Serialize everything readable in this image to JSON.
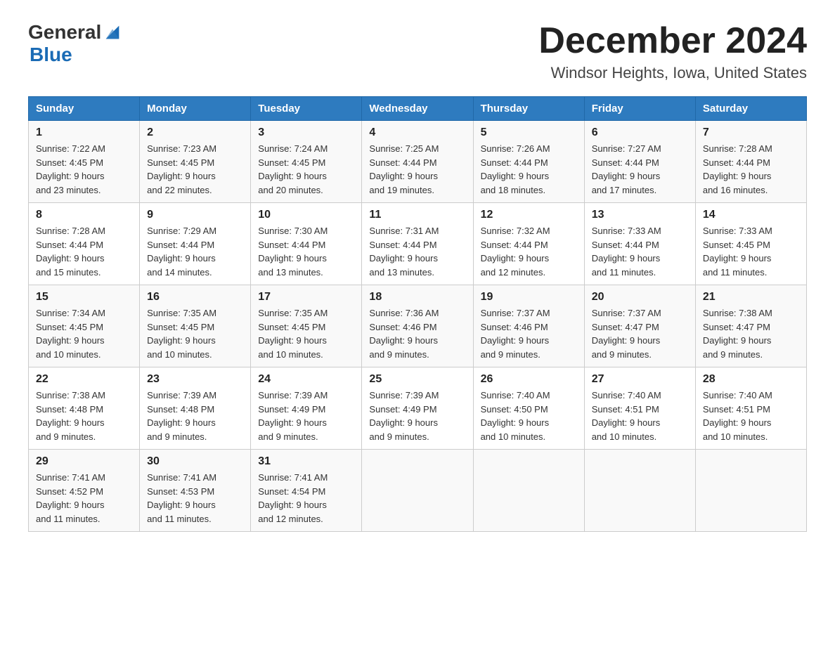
{
  "header": {
    "logo_general": "General",
    "logo_blue": "Blue",
    "month_title": "December 2024",
    "location": "Windsor Heights, Iowa, United States"
  },
  "days_of_week": [
    "Sunday",
    "Monday",
    "Tuesday",
    "Wednesday",
    "Thursday",
    "Friday",
    "Saturday"
  ],
  "weeks": [
    [
      {
        "day": 1,
        "sunrise": "7:22 AM",
        "sunset": "4:45 PM",
        "daylight": "9 hours and 23 minutes."
      },
      {
        "day": 2,
        "sunrise": "7:23 AM",
        "sunset": "4:45 PM",
        "daylight": "9 hours and 22 minutes."
      },
      {
        "day": 3,
        "sunrise": "7:24 AM",
        "sunset": "4:45 PM",
        "daylight": "9 hours and 20 minutes."
      },
      {
        "day": 4,
        "sunrise": "7:25 AM",
        "sunset": "4:44 PM",
        "daylight": "9 hours and 19 minutes."
      },
      {
        "day": 5,
        "sunrise": "7:26 AM",
        "sunset": "4:44 PM",
        "daylight": "9 hours and 18 minutes."
      },
      {
        "day": 6,
        "sunrise": "7:27 AM",
        "sunset": "4:44 PM",
        "daylight": "9 hours and 17 minutes."
      },
      {
        "day": 7,
        "sunrise": "7:28 AM",
        "sunset": "4:44 PM",
        "daylight": "9 hours and 16 minutes."
      }
    ],
    [
      {
        "day": 8,
        "sunrise": "7:28 AM",
        "sunset": "4:44 PM",
        "daylight": "9 hours and 15 minutes."
      },
      {
        "day": 9,
        "sunrise": "7:29 AM",
        "sunset": "4:44 PM",
        "daylight": "9 hours and 14 minutes."
      },
      {
        "day": 10,
        "sunrise": "7:30 AM",
        "sunset": "4:44 PM",
        "daylight": "9 hours and 13 minutes."
      },
      {
        "day": 11,
        "sunrise": "7:31 AM",
        "sunset": "4:44 PM",
        "daylight": "9 hours and 13 minutes."
      },
      {
        "day": 12,
        "sunrise": "7:32 AM",
        "sunset": "4:44 PM",
        "daylight": "9 hours and 12 minutes."
      },
      {
        "day": 13,
        "sunrise": "7:33 AM",
        "sunset": "4:44 PM",
        "daylight": "9 hours and 11 minutes."
      },
      {
        "day": 14,
        "sunrise": "7:33 AM",
        "sunset": "4:45 PM",
        "daylight": "9 hours and 11 minutes."
      }
    ],
    [
      {
        "day": 15,
        "sunrise": "7:34 AM",
        "sunset": "4:45 PM",
        "daylight": "9 hours and 10 minutes."
      },
      {
        "day": 16,
        "sunrise": "7:35 AM",
        "sunset": "4:45 PM",
        "daylight": "9 hours and 10 minutes."
      },
      {
        "day": 17,
        "sunrise": "7:35 AM",
        "sunset": "4:45 PM",
        "daylight": "9 hours and 10 minutes."
      },
      {
        "day": 18,
        "sunrise": "7:36 AM",
        "sunset": "4:46 PM",
        "daylight": "9 hours and 9 minutes."
      },
      {
        "day": 19,
        "sunrise": "7:37 AM",
        "sunset": "4:46 PM",
        "daylight": "9 hours and 9 minutes."
      },
      {
        "day": 20,
        "sunrise": "7:37 AM",
        "sunset": "4:47 PM",
        "daylight": "9 hours and 9 minutes."
      },
      {
        "day": 21,
        "sunrise": "7:38 AM",
        "sunset": "4:47 PM",
        "daylight": "9 hours and 9 minutes."
      }
    ],
    [
      {
        "day": 22,
        "sunrise": "7:38 AM",
        "sunset": "4:48 PM",
        "daylight": "9 hours and 9 minutes."
      },
      {
        "day": 23,
        "sunrise": "7:39 AM",
        "sunset": "4:48 PM",
        "daylight": "9 hours and 9 minutes."
      },
      {
        "day": 24,
        "sunrise": "7:39 AM",
        "sunset": "4:49 PM",
        "daylight": "9 hours and 9 minutes."
      },
      {
        "day": 25,
        "sunrise": "7:39 AM",
        "sunset": "4:49 PM",
        "daylight": "9 hours and 9 minutes."
      },
      {
        "day": 26,
        "sunrise": "7:40 AM",
        "sunset": "4:50 PM",
        "daylight": "9 hours and 10 minutes."
      },
      {
        "day": 27,
        "sunrise": "7:40 AM",
        "sunset": "4:51 PM",
        "daylight": "9 hours and 10 minutes."
      },
      {
        "day": 28,
        "sunrise": "7:40 AM",
        "sunset": "4:51 PM",
        "daylight": "9 hours and 10 minutes."
      }
    ],
    [
      {
        "day": 29,
        "sunrise": "7:41 AM",
        "sunset": "4:52 PM",
        "daylight": "9 hours and 11 minutes."
      },
      {
        "day": 30,
        "sunrise": "7:41 AM",
        "sunset": "4:53 PM",
        "daylight": "9 hours and 11 minutes."
      },
      {
        "day": 31,
        "sunrise": "7:41 AM",
        "sunset": "4:54 PM",
        "daylight": "9 hours and 12 minutes."
      },
      null,
      null,
      null,
      null
    ]
  ],
  "labels": {
    "sunrise": "Sunrise:",
    "sunset": "Sunset:",
    "daylight": "Daylight:"
  }
}
